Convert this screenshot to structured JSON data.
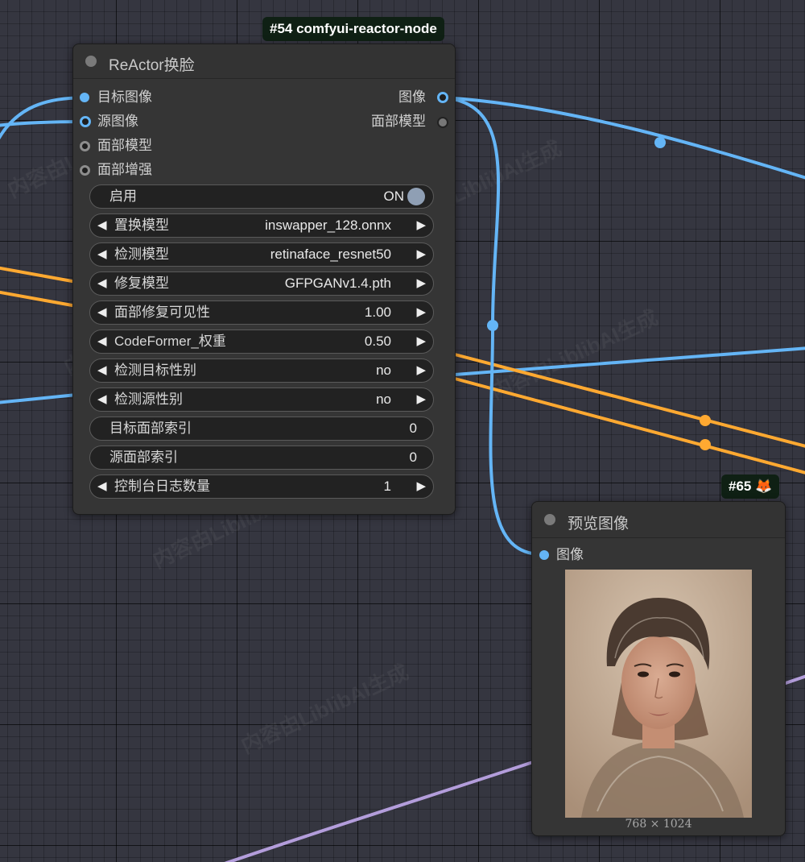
{
  "watermark": "内容由LiblibAI生成",
  "colors": {
    "image_link": "#64b5f6",
    "model_link": "#ffa931",
    "latent_link": "#b39ddb",
    "badge_bg": "#0f2014"
  },
  "reactor_node": {
    "badge": "#54 comfyui-reactor-node",
    "title": "ReActor换脸",
    "inputs": [
      "目标图像",
      "源图像",
      "面部模型",
      "面部增强"
    ],
    "outputs": [
      "图像",
      "面部模型"
    ],
    "widgets": [
      {
        "label": "启用",
        "value": "ON"
      },
      {
        "label": "置换模型",
        "value": "inswapper_128.onnx"
      },
      {
        "label": "检测模型",
        "value": "retinaface_resnet50"
      },
      {
        "label": "修复模型",
        "value": "GFPGANv1.4.pth"
      },
      {
        "label": "面部修复可见性",
        "value": "1.00"
      },
      {
        "label": "CodeFormer_权重",
        "value": "0.50"
      },
      {
        "label": "检测目标性别",
        "value": "no"
      },
      {
        "label": "检测源性别",
        "value": "no"
      },
      {
        "label": "目标面部索引",
        "value": "0"
      },
      {
        "label": "源面部索引",
        "value": "0"
      },
      {
        "label": "控制台日志数量",
        "value": "1"
      }
    ]
  },
  "preview_node": {
    "badge": "#65 🦊",
    "title": "预览图像",
    "input": "图像",
    "image_caption": "768 × 1024"
  }
}
